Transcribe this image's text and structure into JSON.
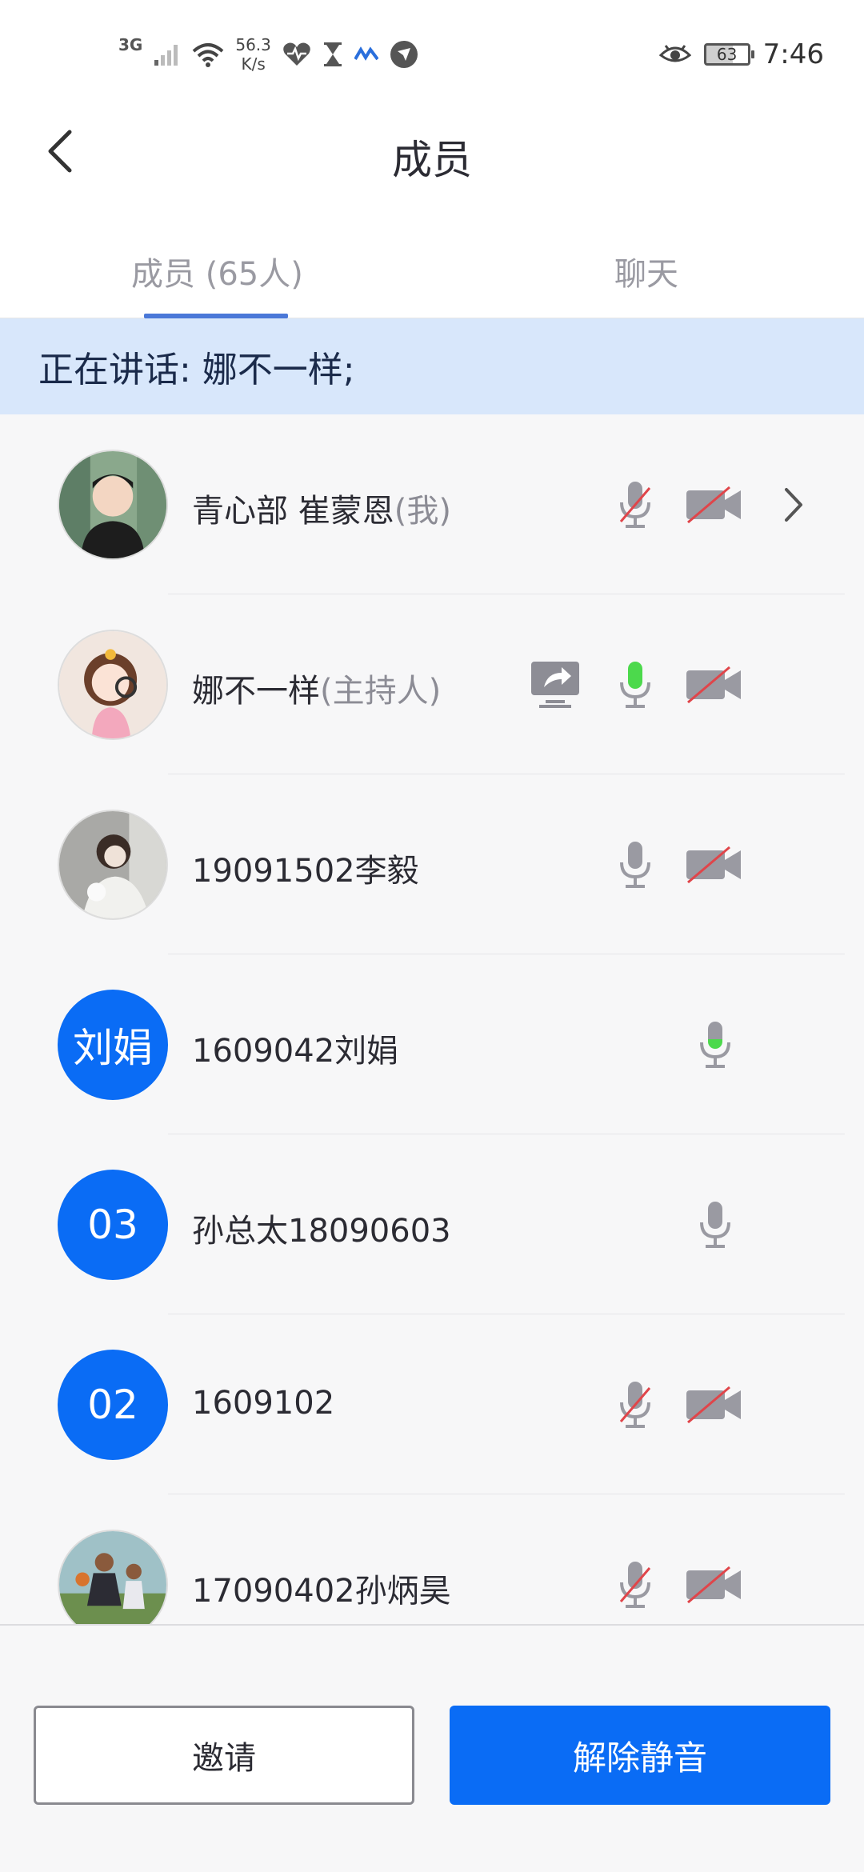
{
  "status_bar": {
    "network": "3G",
    "speed_value": "56.3",
    "speed_unit": "K/s",
    "battery": "63",
    "time": "7:46"
  },
  "header": {
    "title": "成员"
  },
  "tabs": [
    {
      "label": "成员 (65人)",
      "active": true
    },
    {
      "label": "聊天",
      "active": false
    }
  ],
  "speaking_banner": "正在讲话: 娜不一样;",
  "members": [
    {
      "name": "青心部 崔蒙恩",
      "role": "(我)",
      "avatar_type": "image",
      "avatar_text": "",
      "mic": "muted",
      "camera": "off",
      "share": false,
      "chevron": true
    },
    {
      "name": "娜不一样",
      "role": "(主持人)",
      "avatar_type": "image",
      "avatar_text": "",
      "mic": "speaking",
      "camera": "off",
      "share": true,
      "chevron": false
    },
    {
      "name": "19091502李毅",
      "role": "",
      "avatar_type": "image",
      "avatar_text": "",
      "mic": "on",
      "camera": "off",
      "share": false,
      "chevron": false
    },
    {
      "name": "1609042刘娟",
      "role": "",
      "avatar_type": "text",
      "avatar_text": "刘娟",
      "mic": "active-low",
      "camera": "none",
      "share": false,
      "chevron": false
    },
    {
      "name": "孙总太18090603",
      "role": "",
      "avatar_type": "text",
      "avatar_text": "03",
      "mic": "on",
      "camera": "none",
      "share": false,
      "chevron": false
    },
    {
      "name": "1609102",
      "role": "",
      "avatar_type": "text",
      "avatar_text": "02",
      "mic": "muted",
      "camera": "off",
      "share": false,
      "chevron": false
    },
    {
      "name": "17090402孙炳昊",
      "role": "",
      "avatar_type": "image",
      "avatar_text": "",
      "mic": "muted",
      "camera": "off",
      "share": false,
      "chevron": false
    }
  ],
  "buttons": {
    "invite": "邀请",
    "unmute": "解除静音"
  },
  "colors": {
    "primary": "#0a6cf5",
    "banner_bg": "#d8e7fb",
    "mic_active": "#4cd94c",
    "muted_slash": "#e0454a",
    "icon_gray": "#9a9aa2"
  }
}
